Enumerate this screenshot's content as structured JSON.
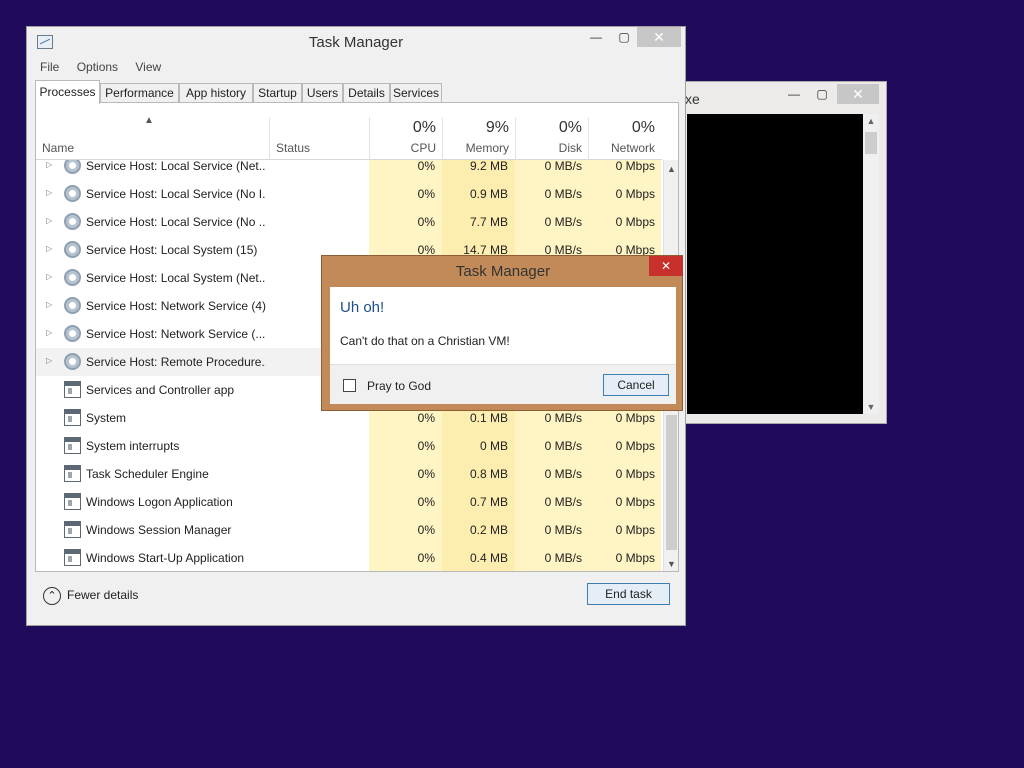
{
  "console_window": {
    "title_fragment": "xe",
    "minimize": "—",
    "maximize": "▢",
    "close": "✕"
  },
  "task_manager": {
    "title": "Task Manager",
    "minimize": "—",
    "maximize": "▢",
    "close": "✕",
    "menu": [
      "File",
      "Options",
      "View"
    ],
    "tabs": [
      "Processes",
      "Performance",
      "App history",
      "Startup",
      "Users",
      "Details",
      "Services"
    ],
    "active_tab": "Processes",
    "columns": {
      "name": "Name",
      "status": "Status",
      "cpu": {
        "pct": "0%",
        "label": "CPU"
      },
      "memory": {
        "pct": "9%",
        "label": "Memory"
      },
      "disk": {
        "pct": "0%",
        "label": "Disk"
      },
      "network": {
        "pct": "0%",
        "label": "Network"
      }
    },
    "rows": [
      {
        "name": "Service Host: Local Service (Net...",
        "cpu": "0%",
        "memory": "9.2 MB",
        "disk": "0 MB/s",
        "network": "0 Mbps",
        "expand": true,
        "icon": "gear"
      },
      {
        "name": "Service Host: Local Service (No I...",
        "cpu": "0%",
        "memory": "0.9 MB",
        "disk": "0 MB/s",
        "network": "0 Mbps",
        "expand": true,
        "icon": "gear"
      },
      {
        "name": "Service Host: Local Service (No ...",
        "cpu": "0%",
        "memory": "7.7 MB",
        "disk": "0 MB/s",
        "network": "0 Mbps",
        "expand": true,
        "icon": "gear"
      },
      {
        "name": "Service Host: Local System (15)",
        "cpu": "0%",
        "memory": "14.7 MB",
        "disk": "0 MB/s",
        "network": "0 Mbps",
        "expand": true,
        "icon": "gear"
      },
      {
        "name": "Service Host: Local System (Net...",
        "cpu": "",
        "memory": "",
        "disk": "",
        "network": "",
        "expand": true,
        "icon": "gear"
      },
      {
        "name": "Service Host: Network Service (4)",
        "cpu": "",
        "memory": "",
        "disk": "",
        "network": "",
        "expand": true,
        "icon": "gear"
      },
      {
        "name": "Service Host: Network Service (...",
        "cpu": "",
        "memory": "",
        "disk": "",
        "network": "",
        "expand": true,
        "icon": "gear"
      },
      {
        "name": "Service Host: Remote Procedure...",
        "cpu": "",
        "memory": "",
        "disk": "",
        "network": "",
        "expand": true,
        "icon": "gear",
        "selected": true
      },
      {
        "name": "Services and Controller app",
        "cpu": "",
        "memory": "",
        "disk": "",
        "network": "",
        "expand": false,
        "icon": "win"
      },
      {
        "name": "System",
        "cpu": "0%",
        "memory": "0.1 MB",
        "disk": "0 MB/s",
        "network": "0 Mbps",
        "expand": false,
        "icon": "win"
      },
      {
        "name": "System interrupts",
        "cpu": "0%",
        "memory": "0 MB",
        "disk": "0 MB/s",
        "network": "0 Mbps",
        "expand": false,
        "icon": "win"
      },
      {
        "name": "Task Scheduler Engine",
        "cpu": "0%",
        "memory": "0.8 MB",
        "disk": "0 MB/s",
        "network": "0 Mbps",
        "expand": false,
        "icon": "win"
      },
      {
        "name": "Windows Logon Application",
        "cpu": "0%",
        "memory": "0.7 MB",
        "disk": "0 MB/s",
        "network": "0 Mbps",
        "expand": false,
        "icon": "win"
      },
      {
        "name": "Windows Session Manager",
        "cpu": "0%",
        "memory": "0.2 MB",
        "disk": "0 MB/s",
        "network": "0 Mbps",
        "expand": false,
        "icon": "win"
      },
      {
        "name": "Windows Start-Up Application",
        "cpu": "0%",
        "memory": "0.4 MB",
        "disk": "0 MB/s",
        "network": "0 Mbps",
        "expand": false,
        "icon": "win"
      }
    ],
    "fewer_details": "Fewer details",
    "end_task": "End task"
  },
  "dialog": {
    "title": "Task Manager",
    "close": "✕",
    "heading": "Uh oh!",
    "message": "Can't do that on a Christian VM!",
    "checkbox_label": "Pray to God",
    "checkbox_checked": false,
    "cancel": "Cancel"
  },
  "colors": {
    "desktop": "#1f0a5c",
    "cpu_col": "#fff4c4",
    "mem_col": "#fdeeb0",
    "disk_col": "#fff4c4",
    "net_col": "#fff4c4",
    "dialog_frame": "#c18a58",
    "dialog_close": "#c8312b",
    "heading": "#1d4f8c"
  }
}
